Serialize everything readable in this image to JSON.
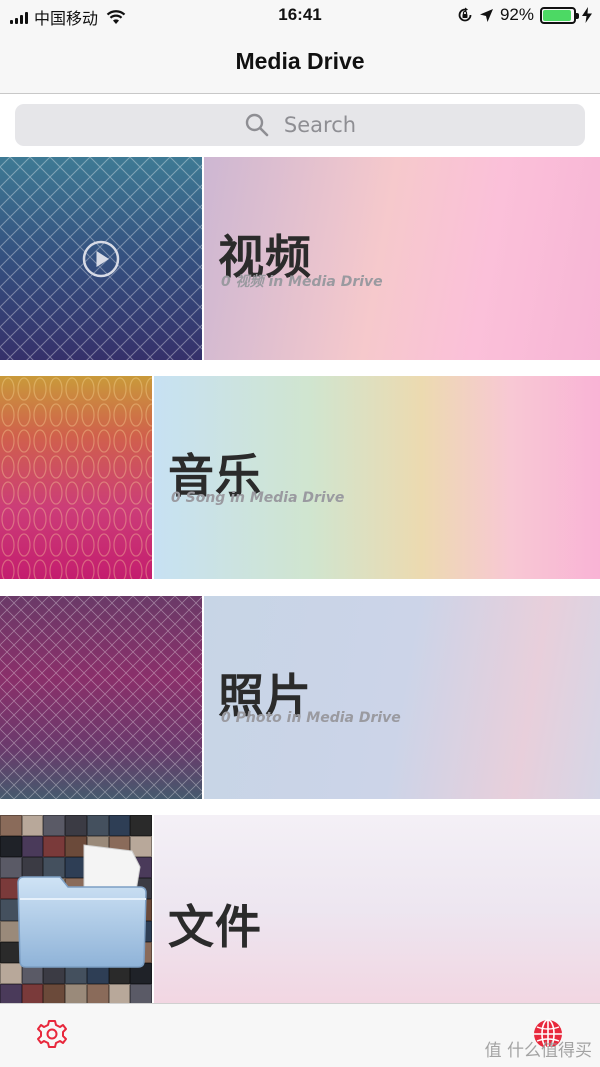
{
  "status_bar": {
    "carrier": "中国移动",
    "time": "16:41",
    "battery_percent": "92%",
    "battery_level": 0.92,
    "icons": [
      "signal-icon",
      "wifi-icon",
      "rotation-lock-icon",
      "location-icon",
      "battery-icon",
      "charging-icon"
    ]
  },
  "nav": {
    "title": "Media Drive"
  },
  "search": {
    "placeholder": "Search"
  },
  "cards": [
    {
      "title": "视频",
      "subtitle": "0 视频 in Media Drive",
      "icon": "play-icon"
    },
    {
      "title": "音乐",
      "subtitle": "0 Song in Media Drive"
    },
    {
      "title": "照片",
      "subtitle": "0 Photo in Media Drive"
    },
    {
      "title": "文件",
      "icon": "folder-icon"
    }
  ],
  "tab_bar": {
    "left_icon": "gear-icon",
    "right_icon": "globe-icon"
  },
  "watermark": "值 什么值得买",
  "colors": {
    "accent": "#e8283c",
    "battery": "#4cd964"
  }
}
